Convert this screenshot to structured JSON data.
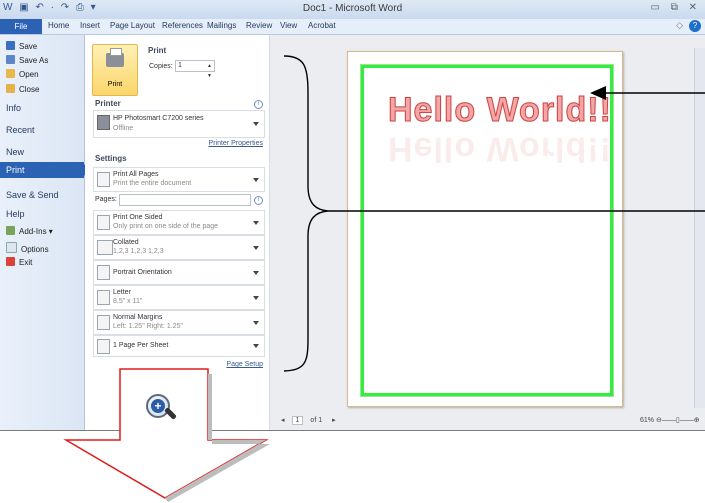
{
  "window": {
    "title": "Doc1 - Microsoft Word",
    "qat": "W ▣ ↶ · ↷ ⎙ ▾",
    "controls": "▭ ⧉ ✕"
  },
  "ribbon_tabs": [
    "File",
    "Home",
    "Insert",
    "Page Layout",
    "References",
    "Mailings",
    "Review",
    "View",
    "Acrobat"
  ],
  "leftnav": {
    "top_items": [
      {
        "label": "Save",
        "icon": "save-icon"
      },
      {
        "label": "Save As",
        "icon": "save-as-icon"
      },
      {
        "label": "Open",
        "icon": "open-folder-icon"
      },
      {
        "label": "Close",
        "icon": "close-folder-icon"
      }
    ],
    "sections": [
      "Info",
      "Recent",
      "New"
    ],
    "selected": "Print",
    "sections2": [
      "Save & Send",
      "Help"
    ],
    "bottom_items": [
      {
        "label": "Add-Ins ▾",
        "icon": "add-ins-icon"
      },
      {
        "label": "Options",
        "icon": "options-icon"
      },
      {
        "label": "Exit",
        "icon": "exit-icon"
      }
    ]
  },
  "print_panel": {
    "heading": "Print",
    "print_button": "Print",
    "copies_label": "Copies:",
    "copies_value": "1",
    "printer_heading": "Printer",
    "printer_name": "HP Photosmart C7200 series",
    "printer_status": "Offline",
    "printer_properties": "Printer Properties",
    "settings_heading": "Settings",
    "pages_label": "Pages:",
    "page_setup": "Page Setup",
    "settings": [
      {
        "main": "Print All Pages",
        "sub": "Print the entire document"
      },
      {
        "main": "Print One Sided",
        "sub": "Only print on one side of the page"
      },
      {
        "main": "Collated",
        "sub": "1,2,3   1,2,3   1,2,3"
      },
      {
        "main": "Portrait Orientation",
        "sub": ""
      },
      {
        "main": "Letter",
        "sub": "8.5\" x 11\""
      },
      {
        "main": "Normal Margins",
        "sub": "Left: 1.25\"   Right: 1.25\""
      },
      {
        "main": "1 Page Per Sheet",
        "sub": ""
      }
    ]
  },
  "preview": {
    "document_text": "Hello World!!",
    "page_current": "1",
    "page_total": "of 1",
    "zoom": "61%"
  },
  "colors": {
    "accent": "#2b62b3",
    "frame": "#33ee3d",
    "arrow_red": "#e01b1b"
  }
}
